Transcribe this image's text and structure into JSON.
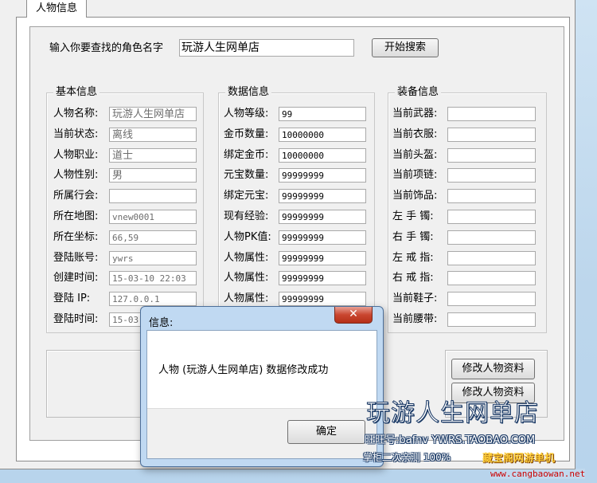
{
  "tab": {
    "label": "人物信息"
  },
  "search": {
    "label": "输入你要查找的角色名字",
    "value": "玩游人生网单店",
    "button": "开始搜索"
  },
  "basic": {
    "title": "基本信息",
    "rows": [
      {
        "label": "人物名称:",
        "value": "玩游人生网单店"
      },
      {
        "label": "当前状态:",
        "value": "离线"
      },
      {
        "label": "人物职业:",
        "value": "道士"
      },
      {
        "label": "人物性别:",
        "value": "男"
      },
      {
        "label": "所属行会:",
        "value": ""
      },
      {
        "label": "所在地图:",
        "value": "vnew0001"
      },
      {
        "label": "所在坐标:",
        "value": "66,59"
      },
      {
        "label": "登陆账号:",
        "value": "ywrs"
      },
      {
        "label": "创建时间:",
        "value": "15-03-10 22:03"
      },
      {
        "label": "登陆 IP:",
        "value": "127.0.0.1"
      },
      {
        "label": "登陆时间:",
        "value": "15-03"
      }
    ]
  },
  "stats": {
    "title": "数据信息",
    "rows": [
      {
        "label": "人物等级:",
        "value": "99"
      },
      {
        "label": "金币数量:",
        "value": "10000000"
      },
      {
        "label": "绑定金币:",
        "value": "10000000"
      },
      {
        "label": "元宝数量:",
        "value": "99999999"
      },
      {
        "label": "绑定元宝:",
        "value": "99999999"
      },
      {
        "label": "现有经验:",
        "value": "99999999"
      },
      {
        "label": "人物PK值:",
        "value": "99999999"
      },
      {
        "label": "人物属性:",
        "value": "99999999"
      },
      {
        "label": "人物属性:",
        "value": "99999999"
      },
      {
        "label": "人物属性:",
        "value": "99999999"
      }
    ]
  },
  "equip": {
    "title": "装备信息",
    "rows": [
      {
        "label": "当前武器:",
        "value": ""
      },
      {
        "label": "当前衣服:",
        "value": ""
      },
      {
        "label": "当前头盔:",
        "value": ""
      },
      {
        "label": "当前项链:",
        "value": ""
      },
      {
        "label": "当前饰品:",
        "value": ""
      },
      {
        "label": "左 手 镯:",
        "value": ""
      },
      {
        "label": "右 手 镯:",
        "value": ""
      },
      {
        "label": "左 戒 指:",
        "value": ""
      },
      {
        "label": "右 戒 指:",
        "value": ""
      },
      {
        "label": "当前鞋子:",
        "value": ""
      },
      {
        "label": "当前腰带:",
        "value": ""
      }
    ]
  },
  "actions": {
    "modify_1": "修改人物资料",
    "modify_2": "修改人物资料"
  },
  "dialog": {
    "title": "信息:",
    "close": "✕",
    "message": "人物 (玩游人生网单店) 数据修改成功",
    "ok": "确定"
  },
  "watermark": {
    "title": "玩游人生网单店",
    "contact": "旺旺号:bafnv  YWRS.TAOBAO.COM",
    "note": "掌柜二次亲测 100%",
    "brand": "藏宝阁网游单机",
    "url": "www.cangbaowan.net"
  },
  "colors": {
    "window_bg": "#f0f0f0",
    "dialog_frame": "#c0d9f2",
    "close_red": "#c9462f",
    "desktop": "#bcd6ec"
  }
}
